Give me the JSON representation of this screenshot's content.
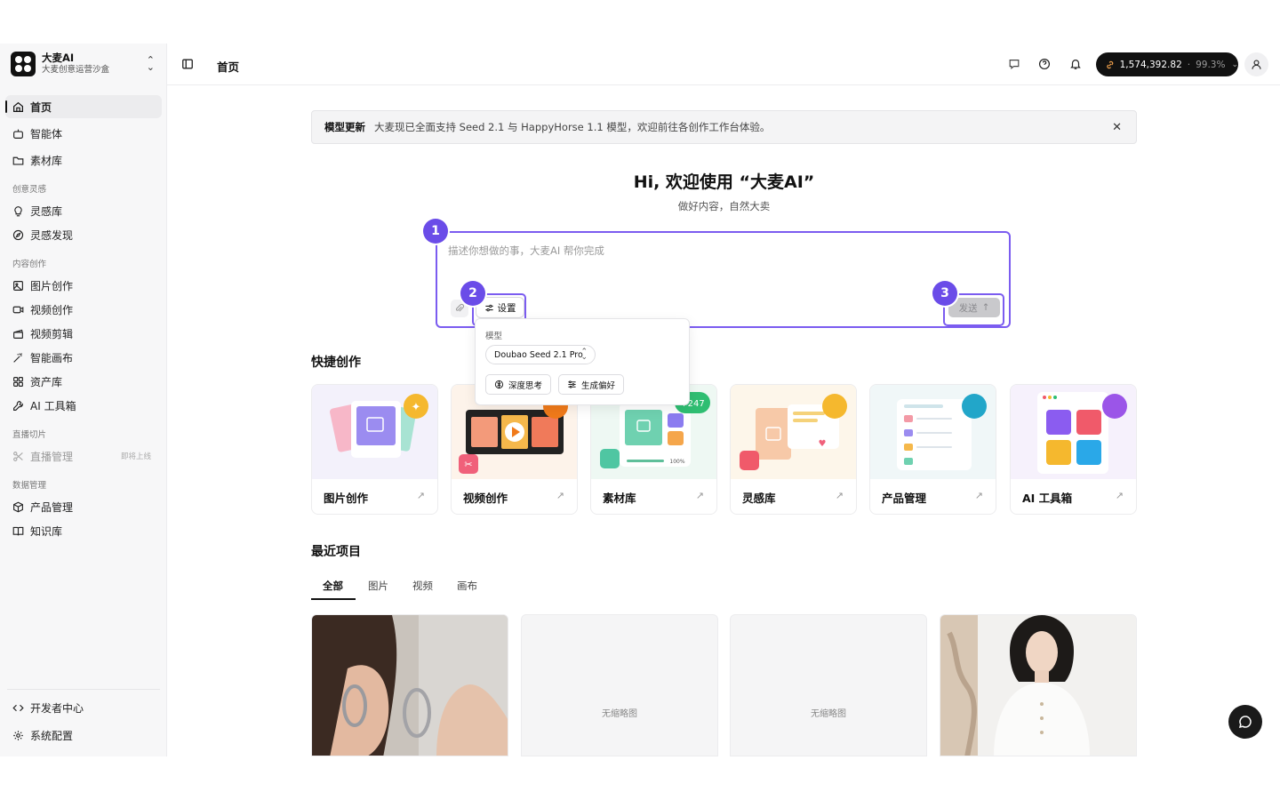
{
  "brand": {
    "name": "大麦AI",
    "subtitle": "大麦创意运营沙盒"
  },
  "sidebar": {
    "items": [
      {
        "label": "首页",
        "icon": "home-icon",
        "active": true
      },
      {
        "label": "智能体",
        "icon": "bot-icon"
      },
      {
        "label": "素材库",
        "icon": "folder-icon"
      }
    ],
    "sections": [
      {
        "title": "创意灵感",
        "items": [
          {
            "label": "灵感库",
            "icon": "lightbulb-icon"
          },
          {
            "label": "灵感发现",
            "icon": "compass-icon"
          }
        ]
      },
      {
        "title": "内容创作",
        "items": [
          {
            "label": "图片创作",
            "icon": "image-icon"
          },
          {
            "label": "视频创作",
            "icon": "video-icon"
          },
          {
            "label": "视频剪辑",
            "icon": "clapperboard-icon"
          },
          {
            "label": "智能画布",
            "icon": "magic-wand-icon"
          },
          {
            "label": "资产库",
            "icon": "grid-icon"
          },
          {
            "label": "AI 工具箱",
            "icon": "wrench-icon"
          }
        ]
      },
      {
        "title": "直播切片",
        "items": [
          {
            "label": "直播管理",
            "icon": "scissors-icon",
            "disabled": true,
            "badge": "即将上线"
          }
        ]
      },
      {
        "title": "数据管理",
        "items": [
          {
            "label": "产品管理",
            "icon": "package-icon"
          },
          {
            "label": "知识库",
            "icon": "book-icon"
          }
        ]
      }
    ],
    "footer": [
      {
        "label": "开发者中心",
        "icon": "code-icon"
      },
      {
        "label": "系统配置",
        "icon": "settings-icon"
      }
    ]
  },
  "header": {
    "title": "首页",
    "balance": "1,574,392.82",
    "balance_sep": "·",
    "balance_pct": "99.3%"
  },
  "banner": {
    "tag": "模型更新",
    "text": "大麦现已全面支持 Seed 2.1 与 HappyHorse 1.1 模型，欢迎前往各创作工作台体验。"
  },
  "hero": {
    "title": "Hi, 欢迎使用 “大麦AI”",
    "subtitle": "做好内容，自然大卖"
  },
  "composer": {
    "placeholder": "描述你想做的事，大麦AI 帮你完成",
    "settings_label": "设置",
    "send_label": "发送",
    "annotations": [
      "1",
      "2",
      "3"
    ]
  },
  "settings_menu": {
    "model_label": "模型",
    "model_value": "Doubao Seed 2.1 Pro",
    "chips": [
      "深度思考",
      "生成偏好"
    ]
  },
  "quick": {
    "title": "快捷创作",
    "cards": [
      {
        "label": "图片创作",
        "accent": "#f5b82e"
      },
      {
        "label": "视频创作",
        "accent": "#f07a1a"
      },
      {
        "label": "素材库",
        "accent": "#2fbe72",
        "badge": "+247"
      },
      {
        "label": "灵感库",
        "accent": "#f5b82e"
      },
      {
        "label": "产品管理",
        "accent": "#22a6c9"
      },
      {
        "label": "AI 工具箱",
        "accent": "#9b55e8"
      }
    ]
  },
  "recent": {
    "title": "最近项目",
    "tabs": [
      "全部",
      "图片",
      "视频",
      "画布"
    ],
    "items": [
      {
        "type": "image"
      },
      {
        "type": "empty",
        "label": "无缩略图"
      },
      {
        "type": "empty",
        "label": "无缩略图"
      },
      {
        "type": "image"
      }
    ]
  }
}
